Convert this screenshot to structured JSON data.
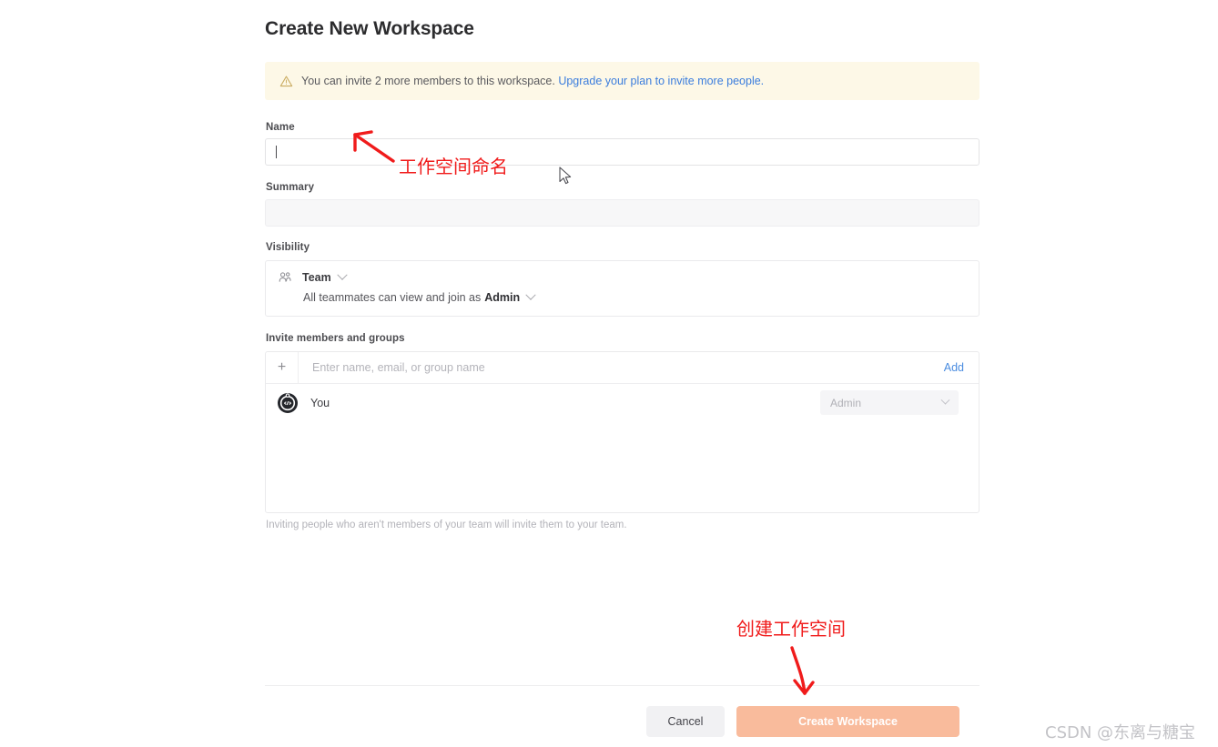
{
  "page": {
    "title": "Create New Workspace"
  },
  "banner": {
    "icon": "warning-triangle-icon",
    "message": "You can invite 2 more members to this workspace.",
    "link_text": "Upgrade your plan to invite more people.",
    "background_color": "#fdf8e7",
    "link_color": "#3b7ddd"
  },
  "form": {
    "name": {
      "label": "Name",
      "value": "",
      "placeholder": ""
    },
    "summary": {
      "label": "Summary",
      "value": "",
      "placeholder": ""
    },
    "visibility": {
      "label": "Visibility",
      "icon": "people-icon",
      "selected": "Team",
      "description_prefix": "All teammates can view and join as",
      "description_role": "Admin"
    },
    "invite": {
      "label": "Invite members and groups",
      "placeholder": "Enter name, email, or group name",
      "add_label": "Add",
      "plus_icon": "plus-icon",
      "members": [
        {
          "avatar": "user-avatar-code-icon",
          "name": "You",
          "role": "Admin"
        }
      ],
      "hint": "Inviting people who aren't members of your team will invite them to your team."
    }
  },
  "footer": {
    "cancel_label": "Cancel",
    "create_label": "Create Workspace",
    "create_button_color": "#f9bb9c",
    "cancel_button_color": "#f1f1f3"
  },
  "annotations": {
    "color": "#f01b1b",
    "name_note": "工作空间命名",
    "create_note": "创建工作空间"
  },
  "watermark": {
    "text": "CSDN @东离与糖宝"
  }
}
